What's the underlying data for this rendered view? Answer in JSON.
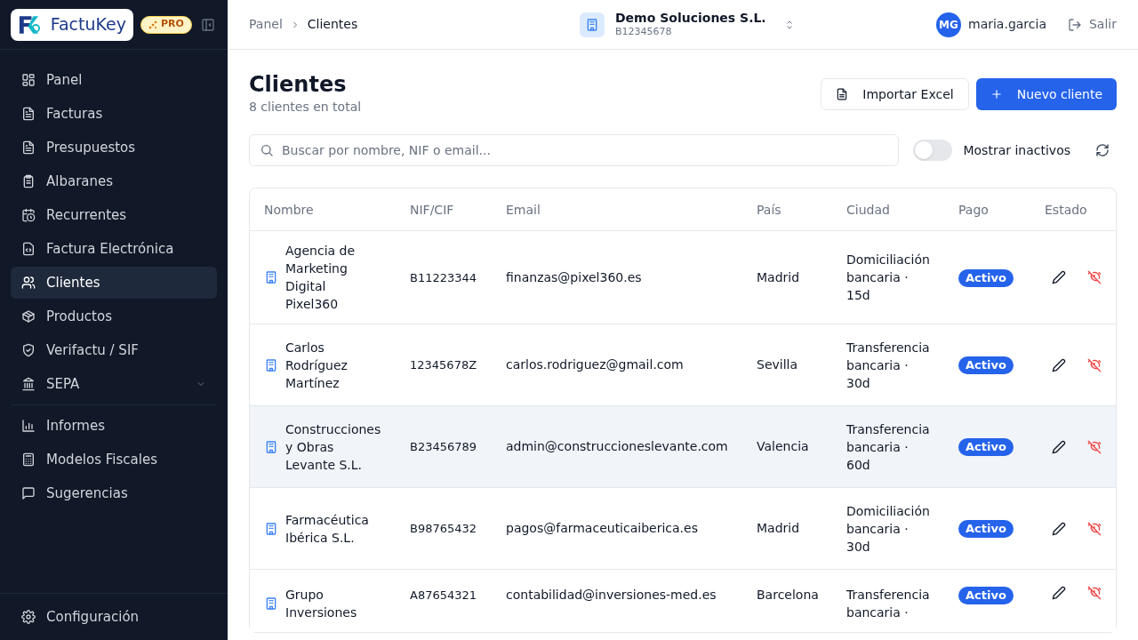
{
  "sidebar": {
    "logo": "FactuKey",
    "plan_badge": "PRO",
    "items": [
      {
        "label": "Panel",
        "selected": false
      },
      {
        "label": "Facturas",
        "selected": false
      },
      {
        "label": "Presupuestos",
        "selected": false
      },
      {
        "label": "Albaranes",
        "selected": false
      },
      {
        "label": "Recurrentes",
        "selected": false
      },
      {
        "label": "Factura Electrónica",
        "selected": false
      },
      {
        "label": "Clientes",
        "selected": true
      },
      {
        "label": "Productos",
        "selected": false
      },
      {
        "label": "Verifactu / SIF",
        "selected": false
      },
      {
        "label": "SEPA",
        "selected": false,
        "expanded": false
      },
      {
        "kind": "divider"
      },
      {
        "label": "Informes",
        "selected": false
      },
      {
        "label": "Modelos Fiscales",
        "selected": false
      },
      {
        "label": "Sugerencias",
        "selected": false
      }
    ],
    "footer_item": {
      "label": "Configuración"
    }
  },
  "breadcrumb": [
    "Panel",
    "Clientes"
  ],
  "company": {
    "name": "Demo Soluciones S.L.",
    "tax_id": "B12345678"
  },
  "user": {
    "initials": "MG",
    "username": "maria.garcia",
    "logout": "Salir"
  },
  "page": {
    "title": "Clientes",
    "subtitle": "8 clientes en total",
    "buttons": [
      {
        "label": "Importar Excel",
        "kind": "secondary"
      },
      {
        "label": "Nuevo cliente",
        "kind": "primary"
      }
    ]
  },
  "search": {
    "placeholder": "Buscar por nombre, NIF o email..."
  },
  "show_inactive": {
    "label": "Mostrar inactivos",
    "on": false
  },
  "table": {
    "columns": [
      "Nombre",
      "NIF/CIF",
      "Email",
      "País",
      "Ciudad",
      "Pago",
      "Estado"
    ],
    "rows": [
      {
        "name": "Agencia de Marketing Digital Pixel360",
        "tax_id": "B11223344",
        "email": "finanzas@pixel360.es",
        "city": "Madrid",
        "payment": "Domiciliación bancaria · 15d",
        "status": "Activo",
        "hovered": false
      },
      {
        "name": "Carlos Rodríguez Martínez",
        "tax_id": "12345678Z",
        "email": "carlos.rodriguez@gmail.com",
        "city": "Sevilla",
        "payment": "Transferencia bancaria · 30d",
        "status": "Activo",
        "hovered": false
      },
      {
        "name": "Construcciones y Obras Levante S.L.",
        "tax_id": "B23456789",
        "email": "admin@construccioneslevante.com",
        "city": "Valencia",
        "payment": "Transferencia bancaria · 60d",
        "status": "Activo",
        "hovered": true
      },
      {
        "name": "Farmacéutica Ibérica S.L.",
        "tax_id": "B98765432",
        "email": "pagos@farmaceuticaiberica.es",
        "city": "Madrid",
        "payment": "Domiciliación bancaria · 30d",
        "status": "Activo",
        "hovered": false
      },
      {
        "name": "Grupo Inversiones",
        "tax_id": "A87654321",
        "email": "contabilidad@inversiones-med.es",
        "city": "Barcelona",
        "payment": "Transferencia bancaria ·",
        "status": "Activo",
        "hovered": false
      }
    ]
  }
}
